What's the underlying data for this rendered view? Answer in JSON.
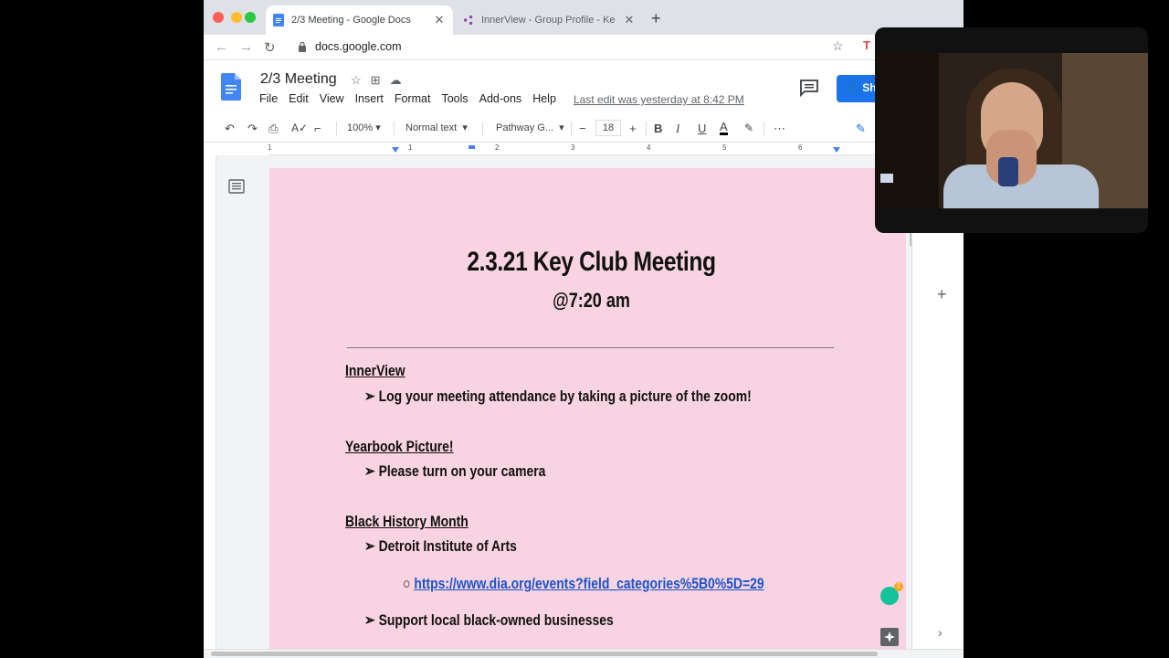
{
  "browser": {
    "tabs": [
      {
        "title": "2/3 Meeting - Google Docs",
        "active": true
      },
      {
        "title": "InnerView - Group Profile - Ke",
        "active": false
      }
    ],
    "url": "docs.google.com"
  },
  "docs": {
    "title": "2/3 Meeting",
    "menu": [
      "File",
      "Edit",
      "View",
      "Insert",
      "Format",
      "Tools",
      "Add-ons",
      "Help"
    ],
    "last_edit": "Last edit was yesterday at 8:42 PM",
    "share_label": "Sh",
    "toolbar": {
      "zoom": "100%",
      "style": "Normal text",
      "font": "Pathway G...",
      "font_size": "18"
    },
    "ruler_marks": [
      "1",
      "1",
      "2",
      "3",
      "4",
      "5",
      "6"
    ]
  },
  "document": {
    "heading": "2.3.21 Key Club Meeting",
    "subheading": "@7:20 am",
    "sections": [
      {
        "title": "InnerView",
        "bullets": [
          "Log your meeting attendance by taking a picture of the zoom!"
        ]
      },
      {
        "title": "Yearbook Picture!",
        "bullets": [
          "Please turn on your camera"
        ]
      },
      {
        "title": "Black History Month",
        "bullets": [
          "Detroit Institute of Arts"
        ],
        "sub_bullets": [
          "https://www.dia.org/events?field_categories%5B0%5D=29"
        ],
        "more_bullets": [
          "Support local black-owned businesses"
        ]
      }
    ],
    "bullet_glyph": "➢",
    "sub_bullet_glyph": "○"
  },
  "grammarly_count": "1",
  "colors": {
    "page_bg": "#f8d3e1",
    "link": "#1a55c8",
    "share_button": "#1a73e8"
  }
}
